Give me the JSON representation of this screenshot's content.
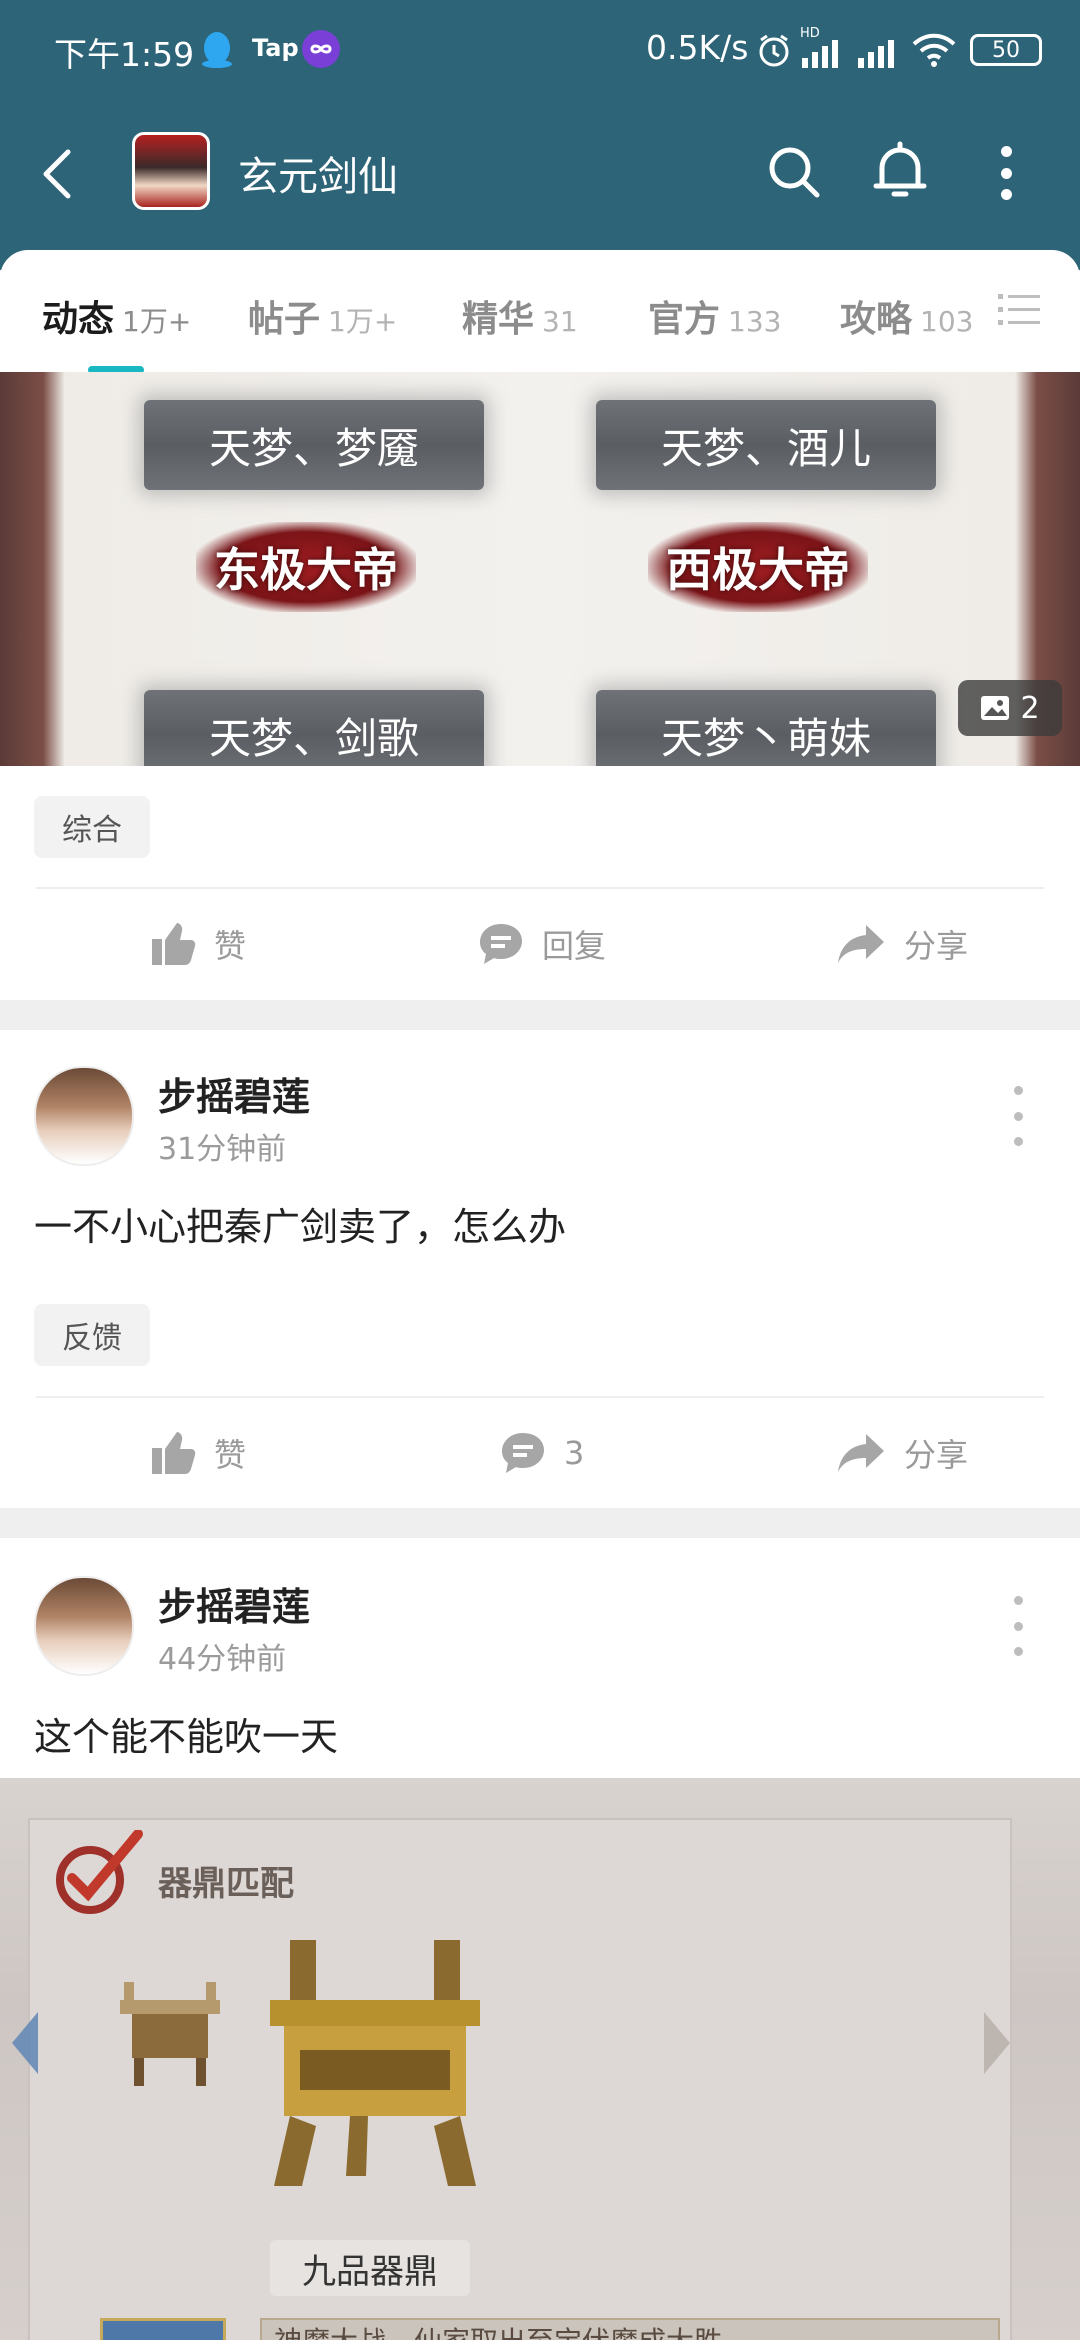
{
  "status_bar": {
    "time": "下午1:59",
    "app_badge": "Tap",
    "net_speed": "0.5K/s",
    "signal_label": "HD",
    "battery": "50"
  },
  "header": {
    "title": "玄元剑仙"
  },
  "tabs": [
    {
      "label": "动态",
      "count": "1万+",
      "active": true
    },
    {
      "label": "帖子",
      "count": "1万+",
      "active": false
    },
    {
      "label": "精华",
      "count": "31",
      "active": false
    },
    {
      "label": "官方",
      "count": "133",
      "active": false
    },
    {
      "label": "攻略",
      "count": "103",
      "active": false
    }
  ],
  "post1": {
    "image": {
      "nameplates": [
        "天梦、梦魇",
        "天梦、酒儿",
        "天梦、剑歌",
        "天梦丶萌妹"
      ],
      "emblems": [
        "东极大帝",
        "西极大帝"
      ],
      "image_count": "2"
    },
    "tag": "综合",
    "actions": {
      "like": "赞",
      "reply": "回复",
      "share": "分享"
    }
  },
  "post2": {
    "author": "步摇碧莲",
    "time": "31分钟前",
    "text": "一不小心把秦广剑卖了，怎么办",
    "tag": "反馈",
    "actions": {
      "like": "赞",
      "reply": "3",
      "share": "分享"
    }
  },
  "post3": {
    "author": "步摇碧莲",
    "time": "44分钟前",
    "text": "这个能不能吹一天",
    "image": {
      "panel_title": "器鼎匹配",
      "item_name": "九品器鼎",
      "caption": "神魔大战，仙家取出至宝伏魔成大胜"
    }
  },
  "colors": {
    "header_bg": "#2d6477",
    "accent": "#19b7c2"
  }
}
